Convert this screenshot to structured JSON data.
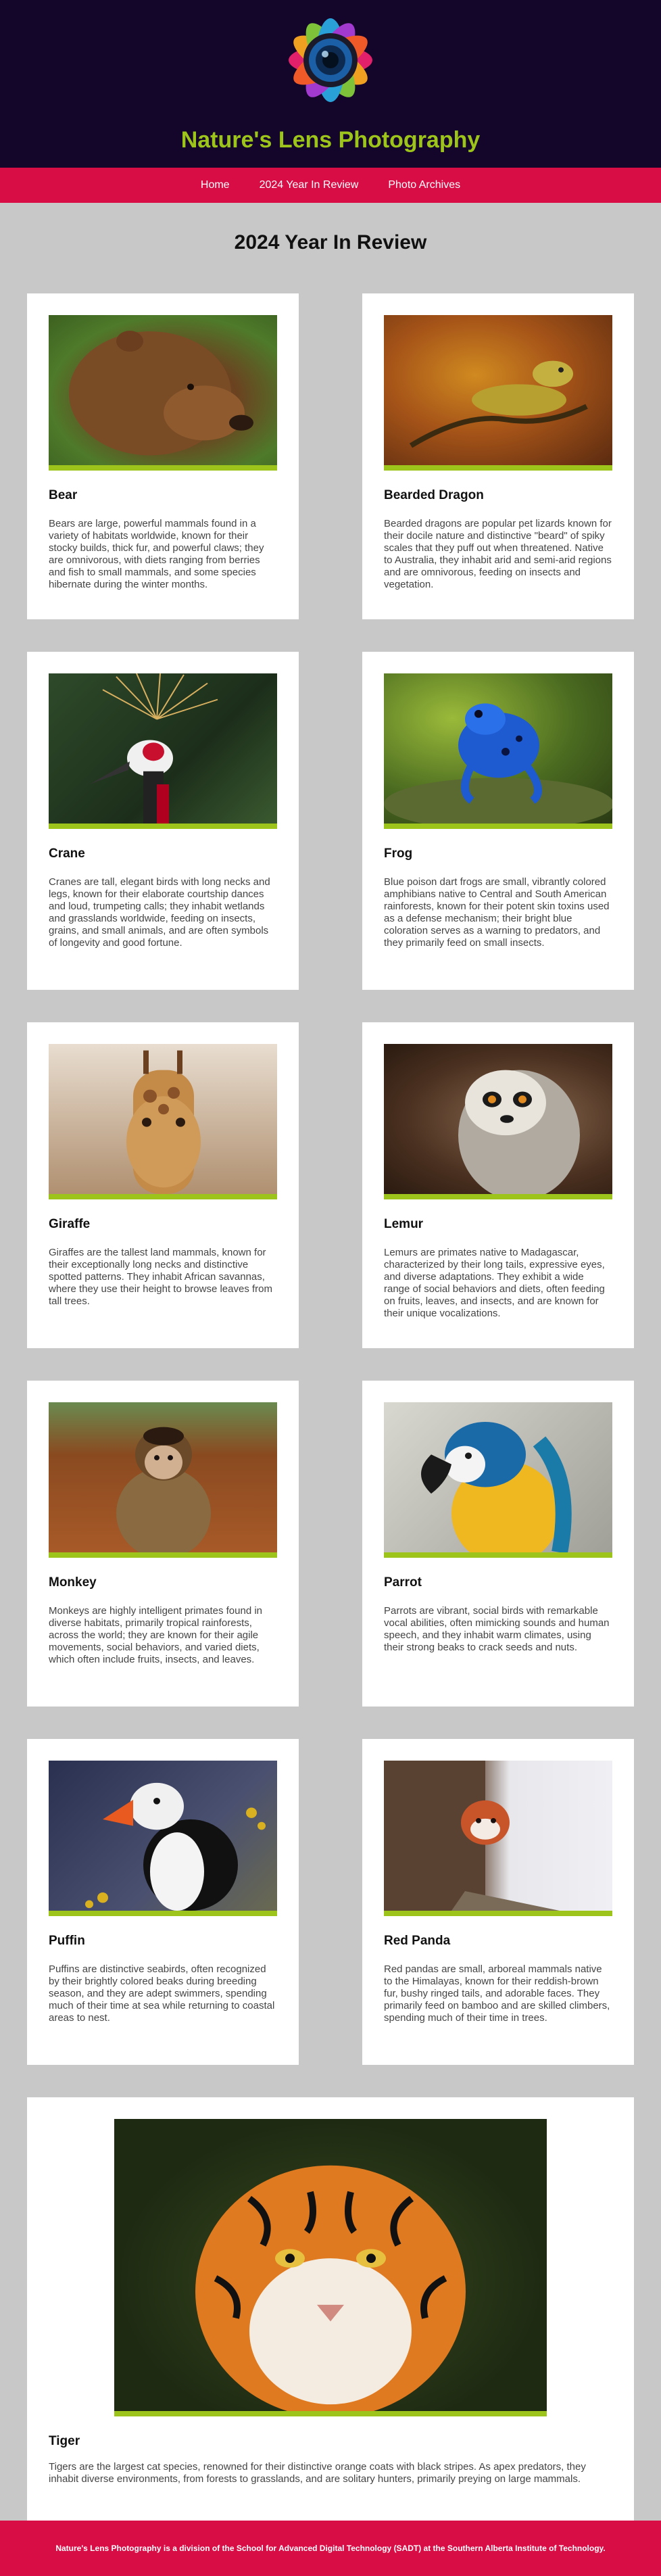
{
  "site": {
    "title": "Nature's Lens Photography"
  },
  "nav": [
    {
      "label": "Home"
    },
    {
      "label": "2024 Year In Review"
    },
    {
      "label": "Photo Archives"
    }
  ],
  "page": {
    "heading": "2024 Year In Review"
  },
  "animals": [
    {
      "name": "Bear",
      "description": "Bears are large, powerful mammals found in a variety of habitats worldwide, known for their stocky builds, thick fur, and powerful claws; they are omnivorous, with diets ranging from berries and fish to small mammals, and some species hibernate during the winter months."
    },
    {
      "name": "Bearded Dragon",
      "description": "Bearded dragons are popular pet lizards known for their docile nature and distinctive \"beard\" of spiky scales that they puff out when threatened. Native to Australia, they inhabit arid and semi-arid regions and are omnivorous, feeding on insects and vegetation."
    },
    {
      "name": "Crane",
      "description": "Cranes are tall, elegant birds with long necks and legs, known for their elaborate courtship dances and loud, trumpeting calls; they inhabit wetlands and grasslands worldwide, feeding on insects, grains, and small animals, and are often symbols of longevity and good fortune."
    },
    {
      "name": "Frog",
      "description": "Blue poison dart frogs are small, vibrantly colored amphibians native to Central and South American rainforests, known for their potent skin toxins used as a defense mechanism; their bright blue coloration serves as a warning to predators, and they primarily feed on small insects."
    },
    {
      "name": "Giraffe",
      "description": "Giraffes are the tallest land mammals, known for their exceptionally long necks and distinctive spotted patterns. They inhabit African savannas, where they use their height to browse leaves from tall trees."
    },
    {
      "name": "Lemur",
      "description": "Lemurs are primates native to Madagascar, characterized by their long tails, expressive eyes, and diverse adaptations. They exhibit a wide range of social behaviors and diets, often feeding on fruits, leaves, and insects, and are known for their unique vocalizations."
    },
    {
      "name": "Monkey",
      "description": "Monkeys are highly intelligent primates found in diverse habitats, primarily tropical rainforests, across the world; they are known for their agile movements, social behaviors, and varied diets, which often include fruits, insects, and leaves."
    },
    {
      "name": "Parrot",
      "description": "Parrots are vibrant, social birds with remarkable vocal abilities, often mimicking sounds and human speech, and they inhabit warm climates, using their strong beaks to crack seeds and nuts."
    },
    {
      "name": "Puffin",
      "description": "Puffins are distinctive seabirds, often recognized by their brightly colored beaks during breeding season, and they are adept swimmers, spending much of their time at sea while returning to coastal areas to nest."
    },
    {
      "name": "Red Panda",
      "description": "Red pandas are small, arboreal mammals native to the Himalayas, known for their reddish-brown fur, bushy ringed tails, and adorable faces. They primarily feed on bamboo and are skilled climbers, spending much of their time in trees."
    },
    {
      "name": "Tiger",
      "description": "Tigers are the largest cat species, renowned for their distinctive orange coats with black stripes. As apex predators, they inhabit diverse environments, from forests to grasslands, and are solitary hunters, primarily preying on large mammals."
    }
  ],
  "footer": {
    "text": "Nature's Lens Photography is a division of the School for Advanced Digital Technology (SADT) at the Southern Alberta Institute of Technology."
  },
  "colors": {
    "header_bg": "#14062a",
    "title_green": "#9dc41a",
    "nav_red": "#d80d45",
    "page_bg": "#c8c8c8"
  }
}
